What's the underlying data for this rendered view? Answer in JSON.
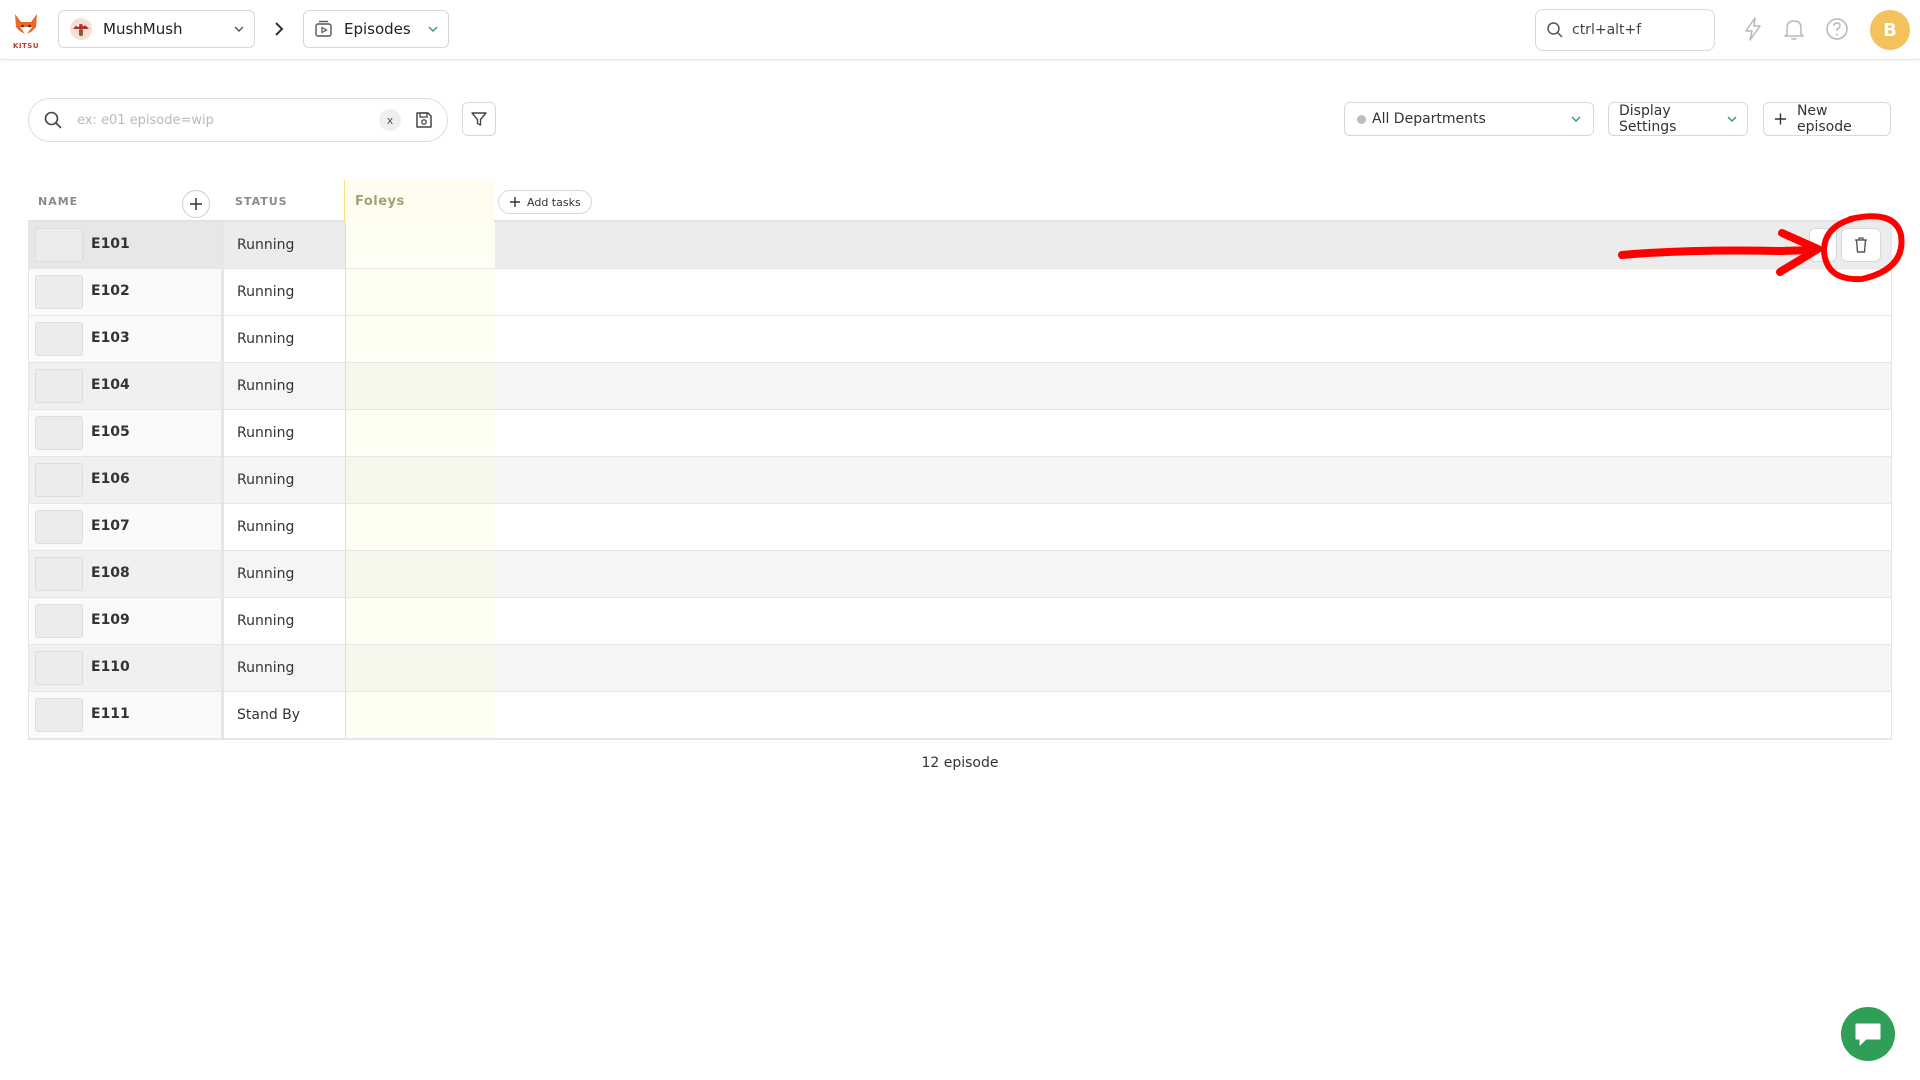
{
  "app": {
    "logo_text": "KITSU",
    "production": "MushMush",
    "section": "Episodes",
    "global_search_placeholder": "ctrl+alt+f",
    "user_initial": "B"
  },
  "toolbar": {
    "search_placeholder": "ex: e01 episode=wip",
    "clear_label": "x",
    "department_select": "All Departments",
    "display_settings_label": "Display Settings",
    "new_episode_label": "New episode"
  },
  "table": {
    "headers": {
      "name": "NAME",
      "status": "STATUS",
      "task_column": "Foleys",
      "add_tasks": "Add tasks"
    },
    "rows": [
      {
        "name": "E101",
        "status": "Running"
      },
      {
        "name": "E102",
        "status": "Running"
      },
      {
        "name": "E103",
        "status": "Running"
      },
      {
        "name": "E104",
        "status": "Running"
      },
      {
        "name": "E105",
        "status": "Running"
      },
      {
        "name": "E106",
        "status": "Running"
      },
      {
        "name": "E107",
        "status": "Running"
      },
      {
        "name": "E108",
        "status": "Running"
      },
      {
        "name": "E109",
        "status": "Running"
      },
      {
        "name": "E110",
        "status": "Running"
      },
      {
        "name": "E111",
        "status": "Stand By"
      }
    ]
  },
  "footer": {
    "count_label": "12 episode"
  },
  "colors": {
    "accent_green": "#2f9e57",
    "avatar": "#f3c25a",
    "annotation_red": "#ff0000",
    "task_column_bg": "#fffef3"
  },
  "icons": {
    "production_avatar": "mushroom-avatar-icon",
    "section": "episodes-icon",
    "search": "search-icon",
    "save": "save-icon",
    "filter": "filter-icon",
    "delete": "trash-icon",
    "lightning": "lightning-icon",
    "notifications": "bell-icon",
    "help": "help-icon",
    "chat": "chat-icon"
  }
}
